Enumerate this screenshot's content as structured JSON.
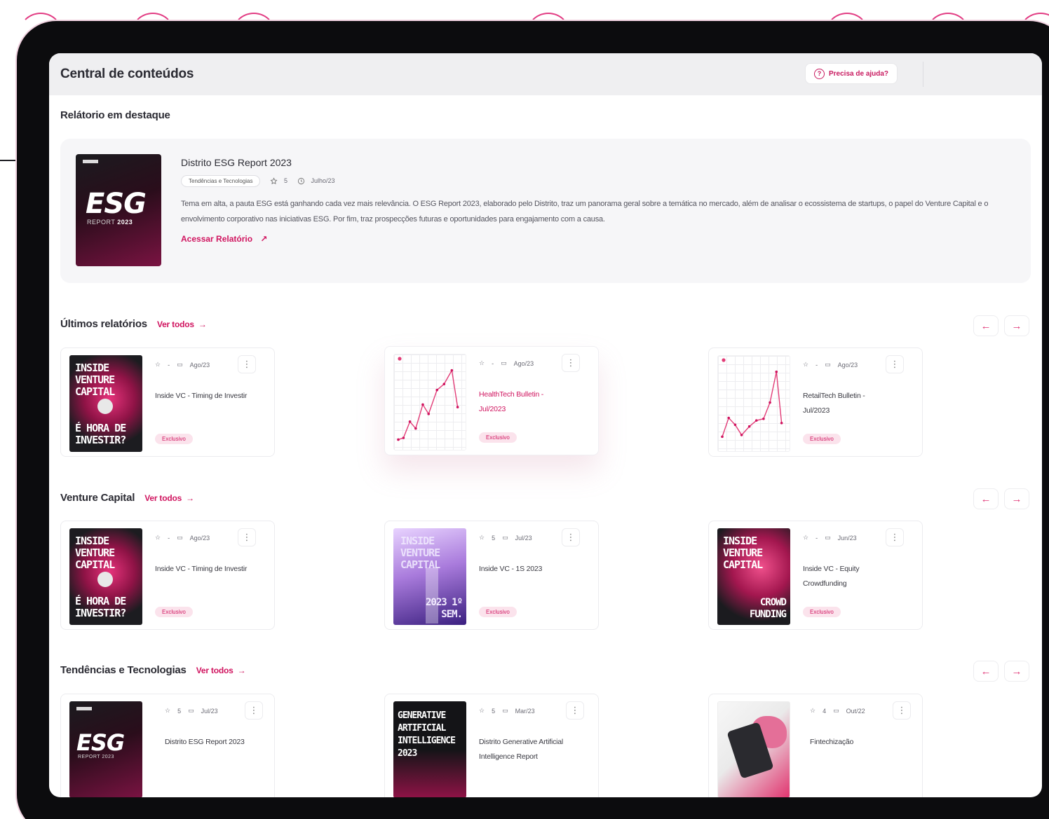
{
  "app": {
    "title": "Central de conteúdos",
    "help_label": "Precisa de ajuda?"
  },
  "featured": {
    "section_title": "Relátorio em destaque",
    "cover": {
      "word": "ESG",
      "sub_prefix": "REPORT",
      "sub_year": "2023"
    },
    "title": "Distrito ESG Report 2023",
    "tag": "Tendências e Tecnologias",
    "stars": "5",
    "date": "Julho/23",
    "description": "Tema em alta, a pauta ESG está ganhando cada vez mais relevância. O ESG Report 2023, elaborado pelo Distrito, traz um panorama geral sobre a temática no mercado, além de analisar o ecossistema de startups, o papel do Venture Capital e o envolvimento corporativo nas iniciativas ESG. Por fim, traz prospecções futuras e oportunidades para engajamento com a causa.",
    "access_label": "Acessar Relatório"
  },
  "see_all_label": "Ver todos",
  "sections": [
    {
      "title": "Últimos relatórios",
      "cards": [
        {
          "title": "Inside VC - Timing de Investir",
          "stars": "-",
          "date": "Ago/23",
          "badge": "Exclusivo",
          "thumb_top": "INSIDE VENTURE CAPITAL",
          "thumb_bottom": "É HORA DE INVESTIR?"
        },
        {
          "title": "HealthTech Bulletin - Jul/2023",
          "stars": "-",
          "date": "Ago/23",
          "badge": "Exclusivo"
        },
        {
          "title": "RetailTech Bulletin - Jul/2023",
          "stars": "-",
          "date": "Ago/23",
          "badge": "Exclusivo"
        }
      ]
    },
    {
      "title": "Venture Capital",
      "cards": [
        {
          "title": "Inside VC - Timing de Investir",
          "stars": "-",
          "date": "Ago/23",
          "badge": "Exclusivo",
          "thumb_top": "INSIDE VENTURE CAPITAL",
          "thumb_bottom": "É HORA DE INVESTIR?"
        },
        {
          "title": "Inside VC - 1S 2023",
          "stars": "5",
          "date": "Jul/23",
          "badge": "Exclusivo",
          "thumb_top": "INSIDE VENTURE CAPITAL",
          "thumb_bottom": "2023 1º SEM."
        },
        {
          "title": "Inside VC - Equity Crowdfunding",
          "stars": "-",
          "date": "Jun/23",
          "badge": "Exclusivo",
          "thumb_top": "INSIDE VENTURE CAPITAL",
          "thumb_bottom": "CROWD FUNDING"
        }
      ]
    },
    {
      "title": "Tendências e Tecnologias",
      "cards": [
        {
          "title": "Distrito ESG Report 2023",
          "stars": "5",
          "date": "Jul/23",
          "thumb_word": "ESG",
          "thumb_sub": "REPORT 2023"
        },
        {
          "title": "Distrito Generative Artificial Intelligence Report",
          "stars": "5",
          "date": "Mar/23",
          "thumb_top": "GENERATIVE ARTIFICIAL INTELLIGENCE 2023"
        },
        {
          "title": "Fintechização",
          "stars": "4",
          "date": "Out/22"
        }
      ]
    }
  ],
  "charts": {
    "healthtech": {
      "points": [
        [
          0,
          0.93
        ],
        [
          0.08,
          0.91
        ],
        [
          0.18,
          0.72
        ],
        [
          0.27,
          0.8
        ],
        [
          0.38,
          0.52
        ],
        [
          0.47,
          0.63
        ],
        [
          0.6,
          0.35
        ],
        [
          0.71,
          0.28
        ],
        [
          0.83,
          0.12
        ],
        [
          0.92,
          0.55
        ]
      ]
    },
    "retailtech": {
      "points": [
        [
          0,
          0.88
        ],
        [
          0.1,
          0.66
        ],
        [
          0.2,
          0.74
        ],
        [
          0.3,
          0.86
        ],
        [
          0.42,
          0.76
        ],
        [
          0.53,
          0.69
        ],
        [
          0.64,
          0.67
        ],
        [
          0.74,
          0.48
        ],
        [
          0.84,
          0.12
        ],
        [
          0.92,
          0.72
        ]
      ]
    }
  },
  "colors": {
    "accent": "#d0145f",
    "badge_bg": "#fbe3ec",
    "frame": "#0c0c0e"
  }
}
